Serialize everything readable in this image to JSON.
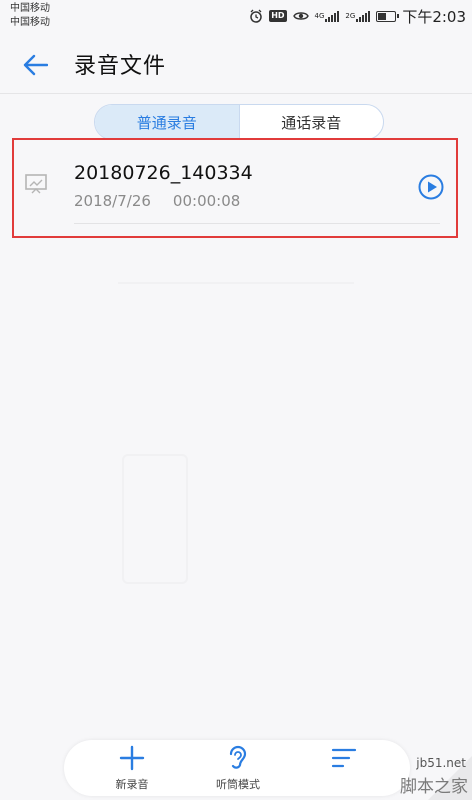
{
  "status_bar": {
    "carrier_1": "中国移动",
    "carrier_2": "中国移动",
    "hd": "HD",
    "net_1": "4G",
    "net_2": "2G",
    "time": "下午2:03"
  },
  "header": {
    "title": "录音文件"
  },
  "tabs": [
    {
      "label": "普通录音",
      "active": true
    },
    {
      "label": "通话录音",
      "active": false
    }
  ],
  "recordings": [
    {
      "name": "20180726_140334",
      "date": "2018/7/26",
      "duration": "00:00:08"
    }
  ],
  "bottom_bar": {
    "new_recording": "新录音",
    "earpiece_mode": "听筒模式"
  },
  "watermark": {
    "site": "jb51.net",
    "brand": "脚本之家"
  },
  "colors": {
    "accent": "#2a7de1",
    "highlight": "#e13b3b",
    "tab_active_bg": "#dbeaf8"
  }
}
